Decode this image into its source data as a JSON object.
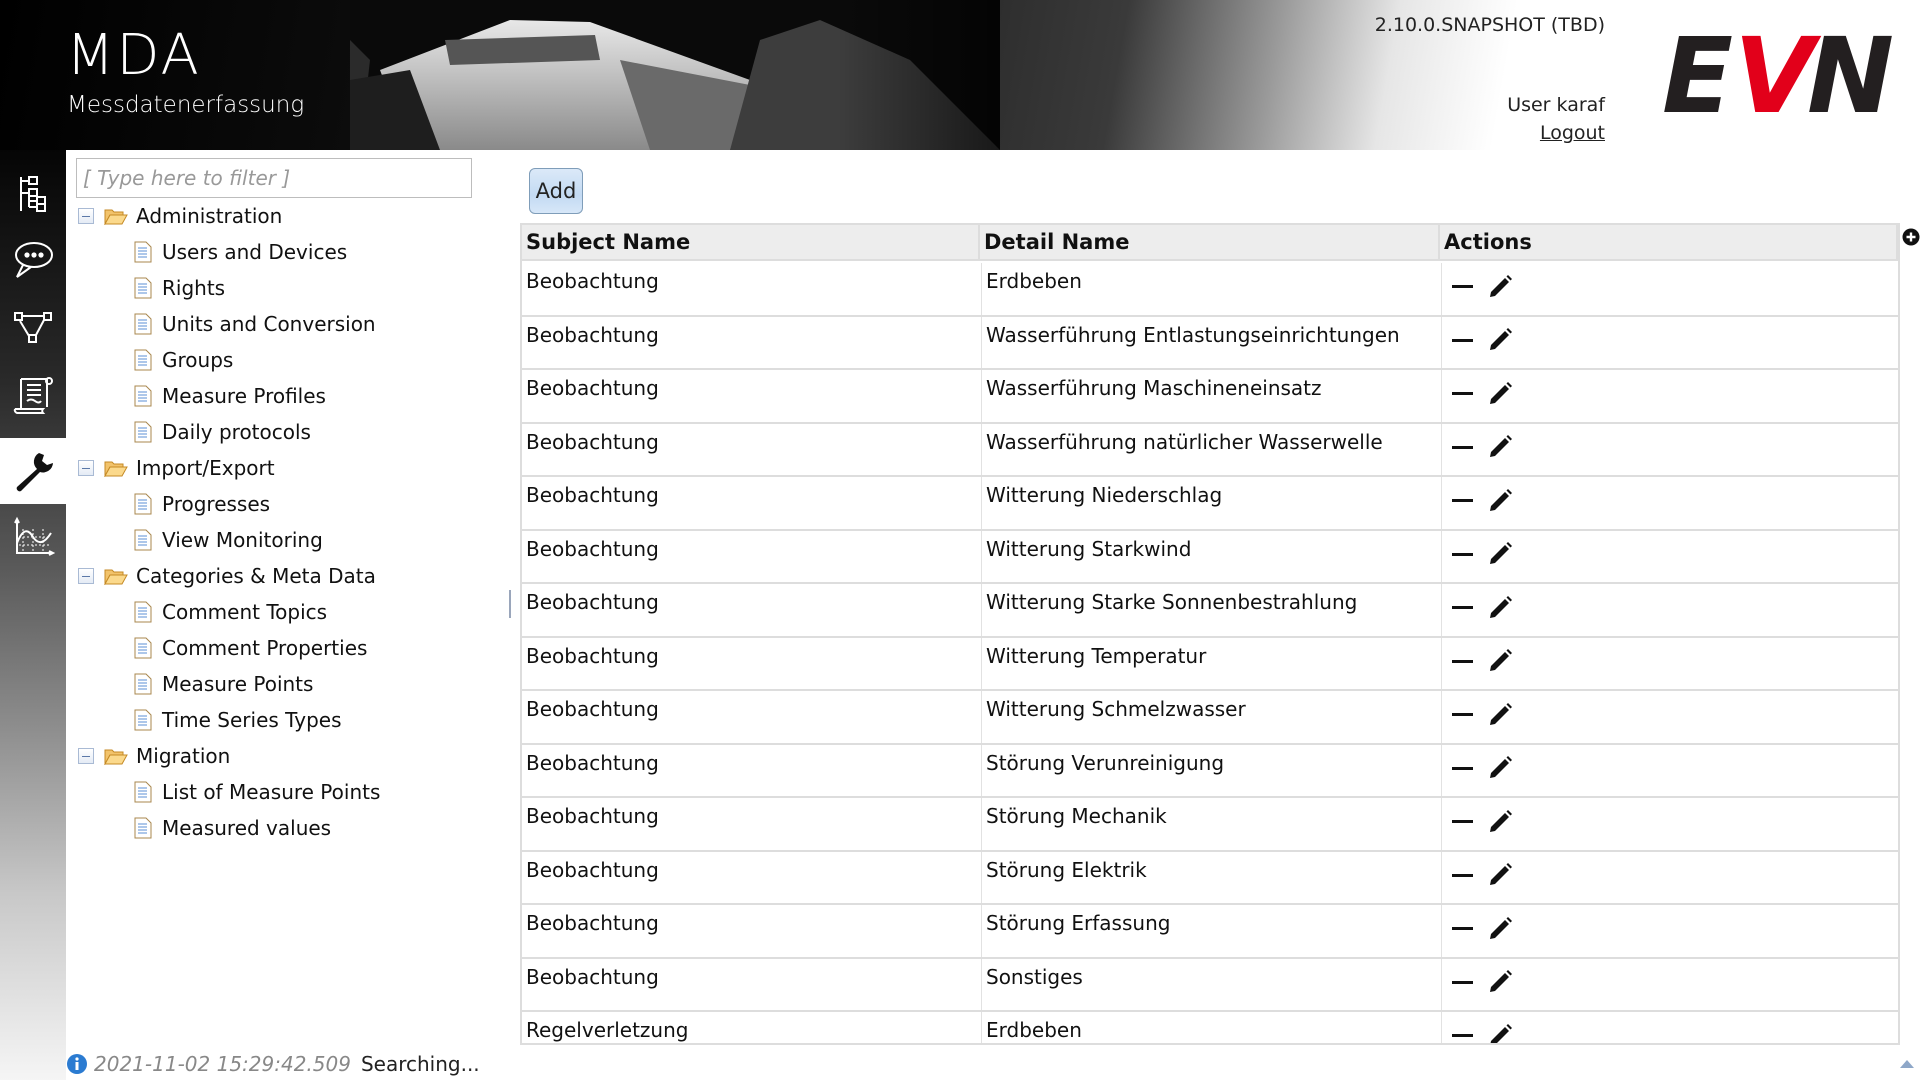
{
  "header": {
    "app_title": "MDA",
    "app_subtitle": "Messdatenerfassung",
    "version": "2.10.0.SNAPSHOT (TBD)",
    "user_label": "User karaf",
    "logout_label": "Logout",
    "logo_text": [
      "E",
      "V",
      "N"
    ],
    "logo_colors": {
      "primary": "#231f20",
      "accent": "#e2001a"
    }
  },
  "iconbar": {
    "items": [
      {
        "icon": "hierarchy-tree-icon",
        "active": false
      },
      {
        "icon": "comment-bubble-icon",
        "active": false
      },
      {
        "icon": "workflow-graph-icon",
        "active": false
      },
      {
        "icon": "scroll-document-icon",
        "active": false
      },
      {
        "icon": "wrench-icon",
        "active": true
      },
      {
        "icon": "chart-curve-icon",
        "active": false
      }
    ]
  },
  "tree": {
    "filter_placeholder": "[ Type here to filter ]",
    "groups": [
      {
        "label": "Administration",
        "expanded": true,
        "children": [
          "Users and Devices",
          "Rights",
          "Units and Conversion",
          "Groups",
          "Measure Profiles",
          "Daily protocols"
        ]
      },
      {
        "label": "Import/Export",
        "expanded": true,
        "children": [
          "Progresses",
          "View Monitoring"
        ]
      },
      {
        "label": "Categories & Meta Data",
        "expanded": true,
        "children": [
          "Comment Topics",
          "Comment Properties",
          "Measure Points",
          "Time Series Types"
        ]
      },
      {
        "label": "Migration",
        "expanded": true,
        "children": [
          "List of Measure Points",
          "Measured values"
        ]
      }
    ]
  },
  "main": {
    "add_label": "Add",
    "table": {
      "columns": [
        "Subject Name",
        "Detail Name",
        "Actions"
      ],
      "rows": [
        {
          "subject": "Beobachtung",
          "detail": "Erdbeben"
        },
        {
          "subject": "Beobachtung",
          "detail": "Wasserführung Entlastungseinrichtungen"
        },
        {
          "subject": "Beobachtung",
          "detail": "Wasserführung Maschineneinsatz"
        },
        {
          "subject": "Beobachtung",
          "detail": "Wasserführung natürlicher Wasserwelle"
        },
        {
          "subject": "Beobachtung",
          "detail": "Witterung Niederschlag"
        },
        {
          "subject": "Beobachtung",
          "detail": "Witterung Starkwind"
        },
        {
          "subject": "Beobachtung",
          "detail": "Witterung Starke Sonnenbestrahlung"
        },
        {
          "subject": "Beobachtung",
          "detail": "Witterung Temperatur"
        },
        {
          "subject": "Beobachtung",
          "detail": "Witterung Schmelzwasser"
        },
        {
          "subject": "Beobachtung",
          "detail": "Störung Verunreinigung"
        },
        {
          "subject": "Beobachtung",
          "detail": "Störung Mechanik"
        },
        {
          "subject": "Beobachtung",
          "detail": "Störung Elektrik"
        },
        {
          "subject": "Beobachtung",
          "detail": "Störung Erfassung"
        },
        {
          "subject": "Beobachtung",
          "detail": "Sonstiges"
        },
        {
          "subject": "Regelverletzung",
          "detail": "Erdbeben"
        }
      ],
      "row_actions": [
        "remove-icon",
        "edit-pencil-icon"
      ]
    }
  },
  "status": {
    "icon": "info-icon",
    "timestamp": "2021-11-02 15:29:42.509",
    "message": "Searching..."
  }
}
